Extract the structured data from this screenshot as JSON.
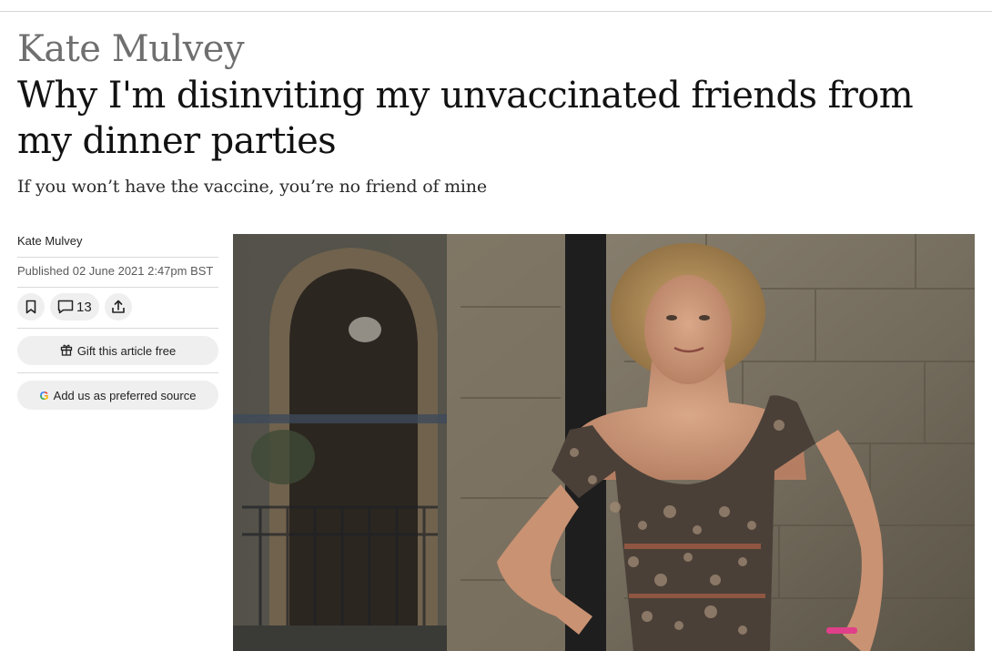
{
  "header": {
    "kicker": "Kate Mulvey",
    "headline": "Why I'm disinviting my unvaccinated friends from my dinner parties",
    "standfirst": "If you won’t have the vaccine, you’re no friend of mine"
  },
  "sidebar": {
    "author": "Kate Mulvey",
    "published": "Published 02 June 2021 2:47pm BST",
    "comments_count": "13",
    "gift_label": "Gift this article free",
    "preferred_source_label": "Add us as preferred source",
    "google_letter": "G"
  },
  "icons": {
    "bookmark": "bookmark-icon",
    "comment": "comment-icon",
    "share": "share-icon",
    "gift": "gift-icon",
    "google": "google-icon"
  },
  "colors": {
    "text": "#121212",
    "kicker": "#6f6f6f",
    "pill_bg": "#efefef",
    "divider": "#d9d9d9"
  }
}
